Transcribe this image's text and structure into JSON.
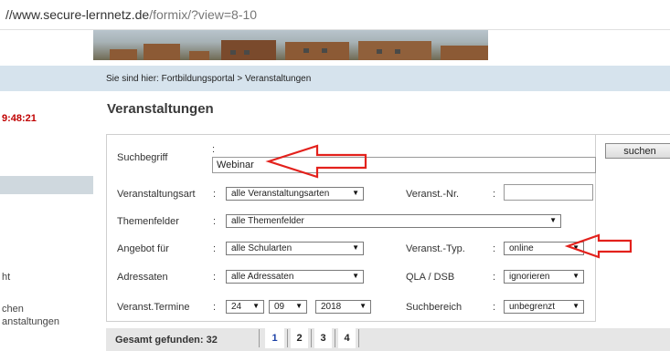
{
  "browser": {
    "url_main": "//www.secure-lernnetz.de",
    "url_path": "/formix/?view=8-10"
  },
  "left_nav": {
    "clock": "9:48:21",
    "item_1": "ht",
    "item_2": "chen",
    "item_3": "anstaltungen"
  },
  "breadcrumb": "Sie sind hier: Fortbildungsportal > Veranstaltungen",
  "page_title": "Veranstaltungen",
  "form": {
    "suchbegriff": {
      "label": "Suchbegriff",
      "colon": ":",
      "value": "Webinar"
    },
    "veranstaltungsart": {
      "label": "Veranstaltungsart",
      "colon": ":",
      "value": "alle Veranstaltungsarten"
    },
    "veranst_nr": {
      "label": "Veranst.-Nr.",
      "colon": ":",
      "value": ""
    },
    "themenfelder": {
      "label": "Themenfelder",
      "colon": ":",
      "value": "alle Themenfelder"
    },
    "angebot_fuer": {
      "label": "Angebot für",
      "colon": ":",
      "value": "alle Schularten"
    },
    "veranst_typ": {
      "label": "Veranst.-Typ.",
      "colon": ":",
      "value": "online"
    },
    "adressaten": {
      "label": "Adressaten",
      "colon": ":",
      "value": "alle Adressaten"
    },
    "qla_dsb": {
      "label": "QLA / DSB",
      "colon": ":",
      "value": "ignorieren"
    },
    "termine": {
      "label": "Veranst.Termine",
      "colon": ":",
      "day": "24",
      "month": "09",
      "year": "2018"
    },
    "suchbereich": {
      "label": "Suchbereich",
      "colon": ":",
      "value": "unbegrenzt"
    },
    "dropdown_arrow": "▼"
  },
  "search_button": "suchen",
  "results": {
    "label": "Gesamt gefunden: 32",
    "pages": [
      "1",
      "2",
      "3",
      "4"
    ]
  },
  "colors": {
    "accent_blue": "#1a3fa6",
    "annotation_red": "#e3211c",
    "clock_red": "#c00000",
    "bar_blue": "#d6e3ed"
  }
}
